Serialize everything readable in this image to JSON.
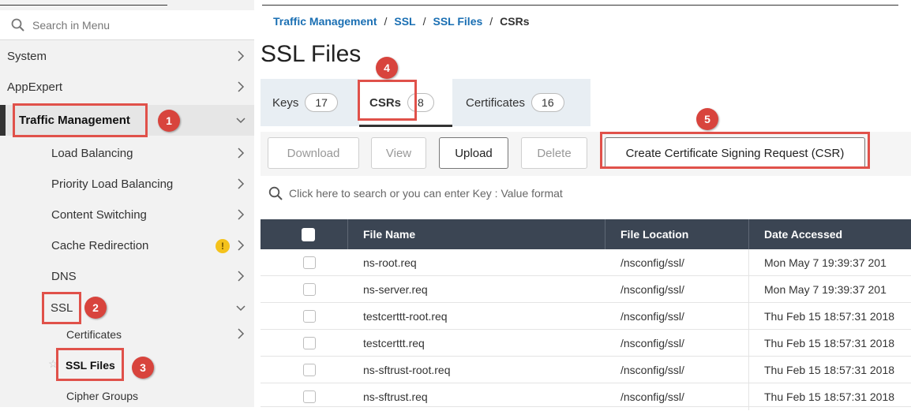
{
  "sidebar": {
    "search_placeholder": "Search in Menu",
    "items": [
      {
        "label": "System"
      },
      {
        "label": "AppExpert"
      },
      {
        "label": "Traffic Management"
      },
      {
        "label": "Load Balancing"
      },
      {
        "label": "Priority Load Balancing"
      },
      {
        "label": "Content Switching"
      },
      {
        "label": "Cache Redirection"
      },
      {
        "label": "DNS"
      },
      {
        "label": "SSL"
      },
      {
        "label": "Certificates"
      },
      {
        "label": "SSL Files"
      },
      {
        "label": "Cipher Groups"
      }
    ]
  },
  "callouts": [
    "1",
    "2",
    "3",
    "4",
    "5"
  ],
  "breadcrumb": {
    "items": [
      "Traffic Management",
      "SSL",
      "SSL Files",
      "CSRs"
    ],
    "separator": "/"
  },
  "page_title": "SSL Files",
  "tabs": [
    {
      "label": "Keys",
      "count": "17"
    },
    {
      "label": "CSRs",
      "count": "8",
      "selected": true
    },
    {
      "label": "Certificates",
      "count": "16"
    }
  ],
  "toolbar": {
    "download": "Download",
    "view": "View",
    "upload": "Upload",
    "delete": "Delete",
    "create_csr": "Create Certificate Signing Request (CSR)"
  },
  "table": {
    "search_placeholder": "Click here to search or you can enter Key : Value format",
    "columns": [
      "File Name",
      "File Location",
      "Date Accessed"
    ],
    "rows": [
      [
        "ns-root.req",
        "/nsconfig/ssl/",
        "Mon May  7 19:39:37 201"
      ],
      [
        "ns-server.req",
        "/nsconfig/ssl/",
        "Mon May  7 19:39:37 201"
      ],
      [
        "testcerttt-root.req",
        "/nsconfig/ssl/",
        "Thu Feb 15 18:57:31 2018"
      ],
      [
        "testcerttt.req",
        "/nsconfig/ssl/",
        "Thu Feb 15 18:57:31 2018"
      ],
      [
        "ns-sftrust-root.req",
        "/nsconfig/ssl/",
        "Thu Feb 15 18:57:31 2018"
      ],
      [
        "ns-sftrust.req",
        "/nsconfig/ssl/",
        "Thu Feb 15 18:57:31 2018"
      ]
    ]
  },
  "colors": {
    "accent_link": "#1a6fb3",
    "callout_red": "#d8443d",
    "table_header": "#3b4553",
    "warning_yellow": "#f4c21c"
  },
  "icons": [
    "search-icon",
    "chevron-right-icon",
    "chevron-down-icon",
    "warning-icon",
    "star-icon",
    "checkbox-icon"
  ]
}
